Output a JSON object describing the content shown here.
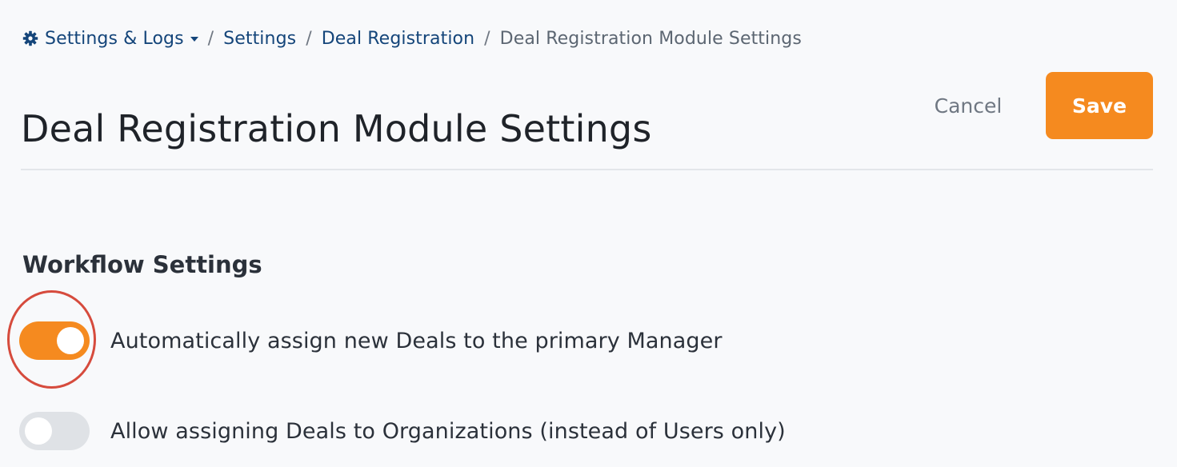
{
  "breadcrumb": {
    "items": [
      {
        "label": "Settings & Logs"
      },
      {
        "label": "Settings"
      },
      {
        "label": "Deal Registration"
      },
      {
        "label": "Deal Registration Module Settings"
      }
    ],
    "separator": "/",
    "icon": "gear-icon"
  },
  "header": {
    "title": "Deal Registration Module Settings",
    "cancel_label": "Cancel",
    "save_label": "Save"
  },
  "workflow": {
    "title": "Workflow Settings",
    "toggles": [
      {
        "label": "Automatically assign new Deals to the primary Manager",
        "enabled": true
      },
      {
        "label": "Allow assigning Deals to Organizations (instead of Users only)",
        "enabled": false
      }
    ]
  },
  "colors": {
    "accent": "#f58a1f",
    "link": "#14457a",
    "annotation": "#d64b3d"
  }
}
